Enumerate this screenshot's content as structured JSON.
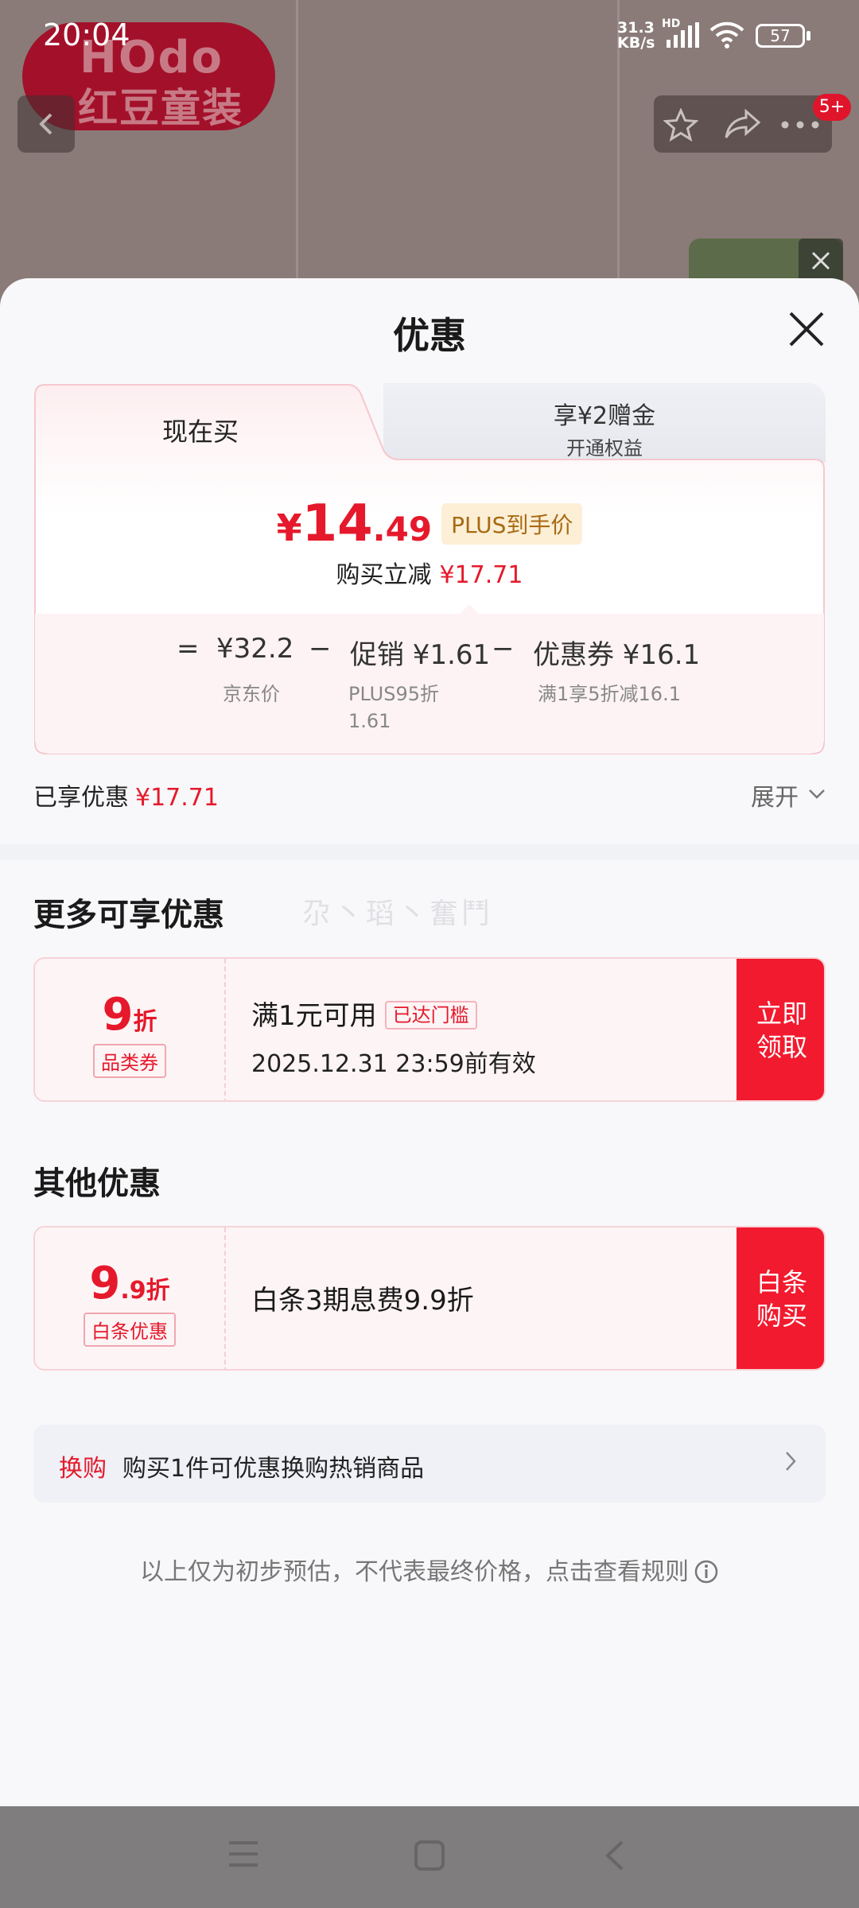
{
  "status_bar": {
    "time": "20:04",
    "net_speed": "31.3",
    "net_unit": "KB/s",
    "net_type": "HD",
    "battery": "57"
  },
  "background": {
    "logo_top": "HOdo",
    "logo_bottom": "红豆童装",
    "badge": "5+"
  },
  "sheet": {
    "title": "优惠",
    "tabs": {
      "now_buy": "现在买",
      "gift_title": "享¥2赠金",
      "gift_sub": "开通权益"
    },
    "price": {
      "currency": "¥",
      "int": "14",
      "dec": ".49",
      "plus_tag": "PLUS到手价"
    },
    "reduce": {
      "label": "购买立减",
      "value": "¥17.71"
    },
    "calc": {
      "eq": "=",
      "jd_price": "¥32.2",
      "jd_label": "京东价",
      "minus1": "−",
      "promo": "促销 ¥1.61",
      "promo_sub1": "PLUS95折",
      "promo_sub2": "1.61",
      "minus2": "−",
      "coupon": "优惠券 ¥16.1",
      "coupon_sub": "满1享5折减16.1"
    },
    "enjoyed": {
      "label": "已享优惠",
      "value": "¥17.71"
    },
    "expand": "展开",
    "more_title": "更多可享优惠",
    "watermark": "尕丶瑫丶奮鬥",
    "coupon1": {
      "big": "9",
      "small": "折",
      "tag": "品类券",
      "line1": "满1元可用",
      "threshold": "已达门槛",
      "line2": "2025.12.31 23:59前有效",
      "btn1": "立即",
      "btn2": "领取"
    },
    "other_title": "其他优惠",
    "coupon2": {
      "big": "9",
      "small": ".9折",
      "tag": "白条优惠",
      "text": "白条3期息费9.9折",
      "btn1": "白条",
      "btn2": "购买"
    },
    "swap": {
      "label": "换购",
      "text": "购买1件可优惠换购热销商品"
    },
    "footnote": "以上仅为初步预估，不代表最终价格，点击查看规则"
  },
  "colors": {
    "accent_red": "#e5192b",
    "plus_gold": "#a86a12"
  }
}
